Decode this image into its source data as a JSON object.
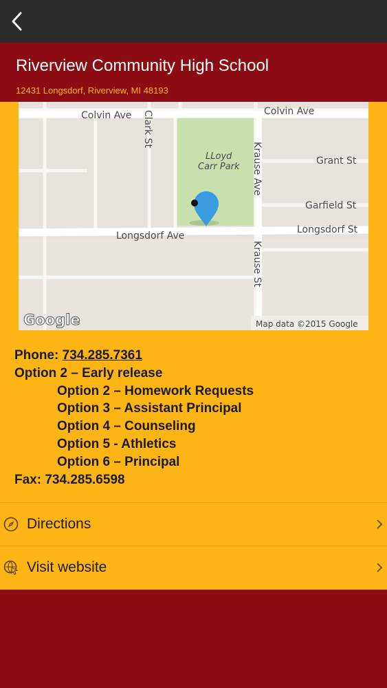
{
  "nav": {
    "back_icon": "chevron-left-icon"
  },
  "header": {
    "title": "Riverview Community High School",
    "address": "12431 Longsdorf, Riverview, MI 48193"
  },
  "map": {
    "streets": {
      "colvin_left": "Colvin Ave",
      "colvin_right": "Colvin Ave",
      "clark": "Clark St",
      "krause_ave": "Krause Ave",
      "grant": "Grant St",
      "garfield": "Garfield St",
      "longsdorf_ave": "Longsdorf Ave",
      "longsdorf_st": "Longsdorf St",
      "krause_st": "Krause St",
      "park_line1": "LLoyd",
      "park_line2": "Carr Park"
    },
    "logo": "Google",
    "attribution": "Map data ©2015 Google",
    "pin_color": "#3b9be0",
    "park_color": "#c8dfae"
  },
  "contact": {
    "phone_label": "Phone: ",
    "phone_number": "734.285.7361",
    "option_main": "Option 2 – Early release",
    "options": [
      "Option 2 – Homework Requests",
      "Option 3 – Assistant Principal",
      "Option 4 – Counseling",
      "Option 5 - Athletics",
      "Option 6 – Principal"
    ],
    "fax": "Fax: 734.285.6598"
  },
  "actions": [
    {
      "label": "Directions",
      "icon": "compass-icon"
    },
    {
      "label": "Visit website",
      "icon": "globe-cursor-icon"
    }
  ],
  "colors": {
    "topbar": "#2b2b2b",
    "brand_maroon": "#8b0c12",
    "brand_gold": "#fdb515",
    "address_text": "#ffb612"
  }
}
